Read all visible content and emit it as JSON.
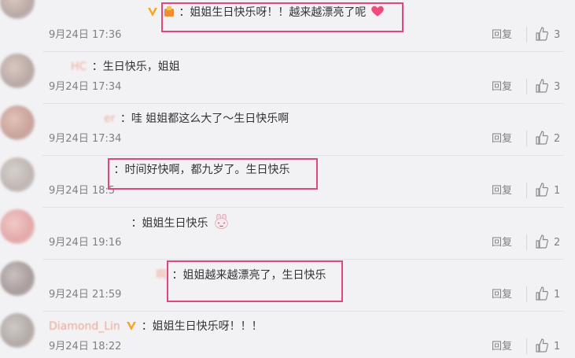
{
  "reply_label": "回复",
  "comments": [
    {
      "user": "",
      "text": "：姐姐生日快乐呀！！越来越漂亮了呢",
      "time": "9月24日 17:36",
      "likes": "3"
    },
    {
      "user": "HC",
      "text": "：生日快乐，姐姐",
      "time": "9月24日 17:34",
      "likes": "3"
    },
    {
      "user": "er",
      "text": "：哇 姐姐都这么大了～生日快乐啊",
      "time": "9月24日 17:34",
      "likes": "2"
    },
    {
      "user": "",
      "text": "：时间好快啊，都九岁了。生日快乐",
      "time": "9月24日 18:5",
      "likes": "1"
    },
    {
      "user": "",
      "text": "：姐姐生日快乐",
      "time": "9月24日 19:16",
      "likes": "2"
    },
    {
      "user": "啊",
      "text": "：姐姐越来越漂亮了，生日快乐",
      "time": "9月24日 21:59",
      "likes": "1"
    },
    {
      "user": "Diamond_Lin",
      "text": "：姐姐生日快乐呀！！！",
      "time": "9月24日 18:22",
      "likes": "1"
    }
  ],
  "colors": {
    "highlight": "#e3467f",
    "username": "#eb7350",
    "meta": "#808080",
    "verified": "#f5a623"
  },
  "icons": [
    "thumbs-up-icon",
    "verified-v-icon",
    "heart-emoji-icon",
    "bunny-emoji-icon"
  ]
}
